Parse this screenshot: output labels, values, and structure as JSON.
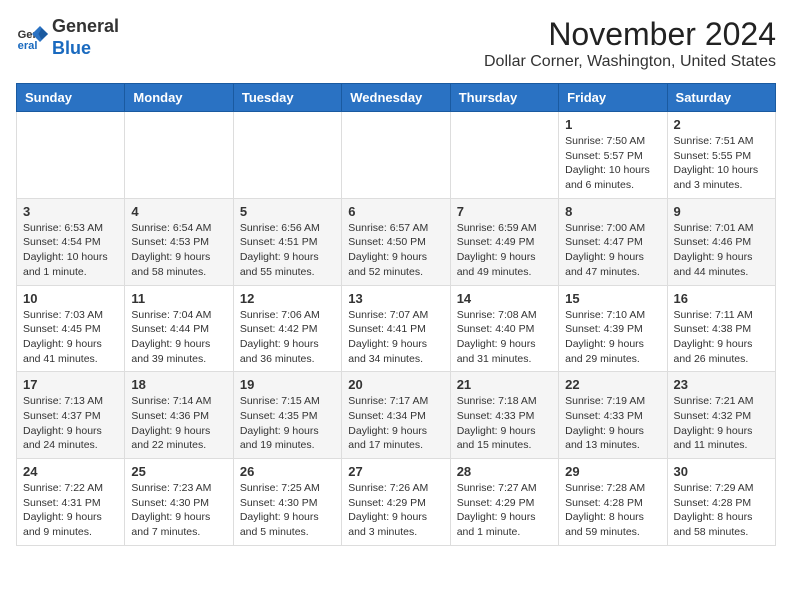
{
  "header": {
    "logo": {
      "general": "General",
      "blue": "Blue"
    },
    "month_title": "November 2024",
    "location": "Dollar Corner, Washington, United States"
  },
  "calendar": {
    "day_headers": [
      "Sunday",
      "Monday",
      "Tuesday",
      "Wednesday",
      "Thursday",
      "Friday",
      "Saturday"
    ],
    "weeks": [
      [
        {
          "day": "",
          "info": ""
        },
        {
          "day": "",
          "info": ""
        },
        {
          "day": "",
          "info": ""
        },
        {
          "day": "",
          "info": ""
        },
        {
          "day": "",
          "info": ""
        },
        {
          "day": "1",
          "info": "Sunrise: 7:50 AM\nSunset: 5:57 PM\nDaylight: 10 hours and 6 minutes."
        },
        {
          "day": "2",
          "info": "Sunrise: 7:51 AM\nSunset: 5:55 PM\nDaylight: 10 hours and 3 minutes."
        }
      ],
      [
        {
          "day": "3",
          "info": "Sunrise: 6:53 AM\nSunset: 4:54 PM\nDaylight: 10 hours and 1 minute."
        },
        {
          "day": "4",
          "info": "Sunrise: 6:54 AM\nSunset: 4:53 PM\nDaylight: 9 hours and 58 minutes."
        },
        {
          "day": "5",
          "info": "Sunrise: 6:56 AM\nSunset: 4:51 PM\nDaylight: 9 hours and 55 minutes."
        },
        {
          "day": "6",
          "info": "Sunrise: 6:57 AM\nSunset: 4:50 PM\nDaylight: 9 hours and 52 minutes."
        },
        {
          "day": "7",
          "info": "Sunrise: 6:59 AM\nSunset: 4:49 PM\nDaylight: 9 hours and 49 minutes."
        },
        {
          "day": "8",
          "info": "Sunrise: 7:00 AM\nSunset: 4:47 PM\nDaylight: 9 hours and 47 minutes."
        },
        {
          "day": "9",
          "info": "Sunrise: 7:01 AM\nSunset: 4:46 PM\nDaylight: 9 hours and 44 minutes."
        }
      ],
      [
        {
          "day": "10",
          "info": "Sunrise: 7:03 AM\nSunset: 4:45 PM\nDaylight: 9 hours and 41 minutes."
        },
        {
          "day": "11",
          "info": "Sunrise: 7:04 AM\nSunset: 4:44 PM\nDaylight: 9 hours and 39 minutes."
        },
        {
          "day": "12",
          "info": "Sunrise: 7:06 AM\nSunset: 4:42 PM\nDaylight: 9 hours and 36 minutes."
        },
        {
          "day": "13",
          "info": "Sunrise: 7:07 AM\nSunset: 4:41 PM\nDaylight: 9 hours and 34 minutes."
        },
        {
          "day": "14",
          "info": "Sunrise: 7:08 AM\nSunset: 4:40 PM\nDaylight: 9 hours and 31 minutes."
        },
        {
          "day": "15",
          "info": "Sunrise: 7:10 AM\nSunset: 4:39 PM\nDaylight: 9 hours and 29 minutes."
        },
        {
          "day": "16",
          "info": "Sunrise: 7:11 AM\nSunset: 4:38 PM\nDaylight: 9 hours and 26 minutes."
        }
      ],
      [
        {
          "day": "17",
          "info": "Sunrise: 7:13 AM\nSunset: 4:37 PM\nDaylight: 9 hours and 24 minutes."
        },
        {
          "day": "18",
          "info": "Sunrise: 7:14 AM\nSunset: 4:36 PM\nDaylight: 9 hours and 22 minutes."
        },
        {
          "day": "19",
          "info": "Sunrise: 7:15 AM\nSunset: 4:35 PM\nDaylight: 9 hours and 19 minutes."
        },
        {
          "day": "20",
          "info": "Sunrise: 7:17 AM\nSunset: 4:34 PM\nDaylight: 9 hours and 17 minutes."
        },
        {
          "day": "21",
          "info": "Sunrise: 7:18 AM\nSunset: 4:33 PM\nDaylight: 9 hours and 15 minutes."
        },
        {
          "day": "22",
          "info": "Sunrise: 7:19 AM\nSunset: 4:33 PM\nDaylight: 9 hours and 13 minutes."
        },
        {
          "day": "23",
          "info": "Sunrise: 7:21 AM\nSunset: 4:32 PM\nDaylight: 9 hours and 11 minutes."
        }
      ],
      [
        {
          "day": "24",
          "info": "Sunrise: 7:22 AM\nSunset: 4:31 PM\nDaylight: 9 hours and 9 minutes."
        },
        {
          "day": "25",
          "info": "Sunrise: 7:23 AM\nSunset: 4:30 PM\nDaylight: 9 hours and 7 minutes."
        },
        {
          "day": "26",
          "info": "Sunrise: 7:25 AM\nSunset: 4:30 PM\nDaylight: 9 hours and 5 minutes."
        },
        {
          "day": "27",
          "info": "Sunrise: 7:26 AM\nSunset: 4:29 PM\nDaylight: 9 hours and 3 minutes."
        },
        {
          "day": "28",
          "info": "Sunrise: 7:27 AM\nSunset: 4:29 PM\nDaylight: 9 hours and 1 minute."
        },
        {
          "day": "29",
          "info": "Sunrise: 7:28 AM\nSunset: 4:28 PM\nDaylight: 8 hours and 59 minutes."
        },
        {
          "day": "30",
          "info": "Sunrise: 7:29 AM\nSunset: 4:28 PM\nDaylight: 8 hours and 58 minutes."
        }
      ]
    ]
  }
}
